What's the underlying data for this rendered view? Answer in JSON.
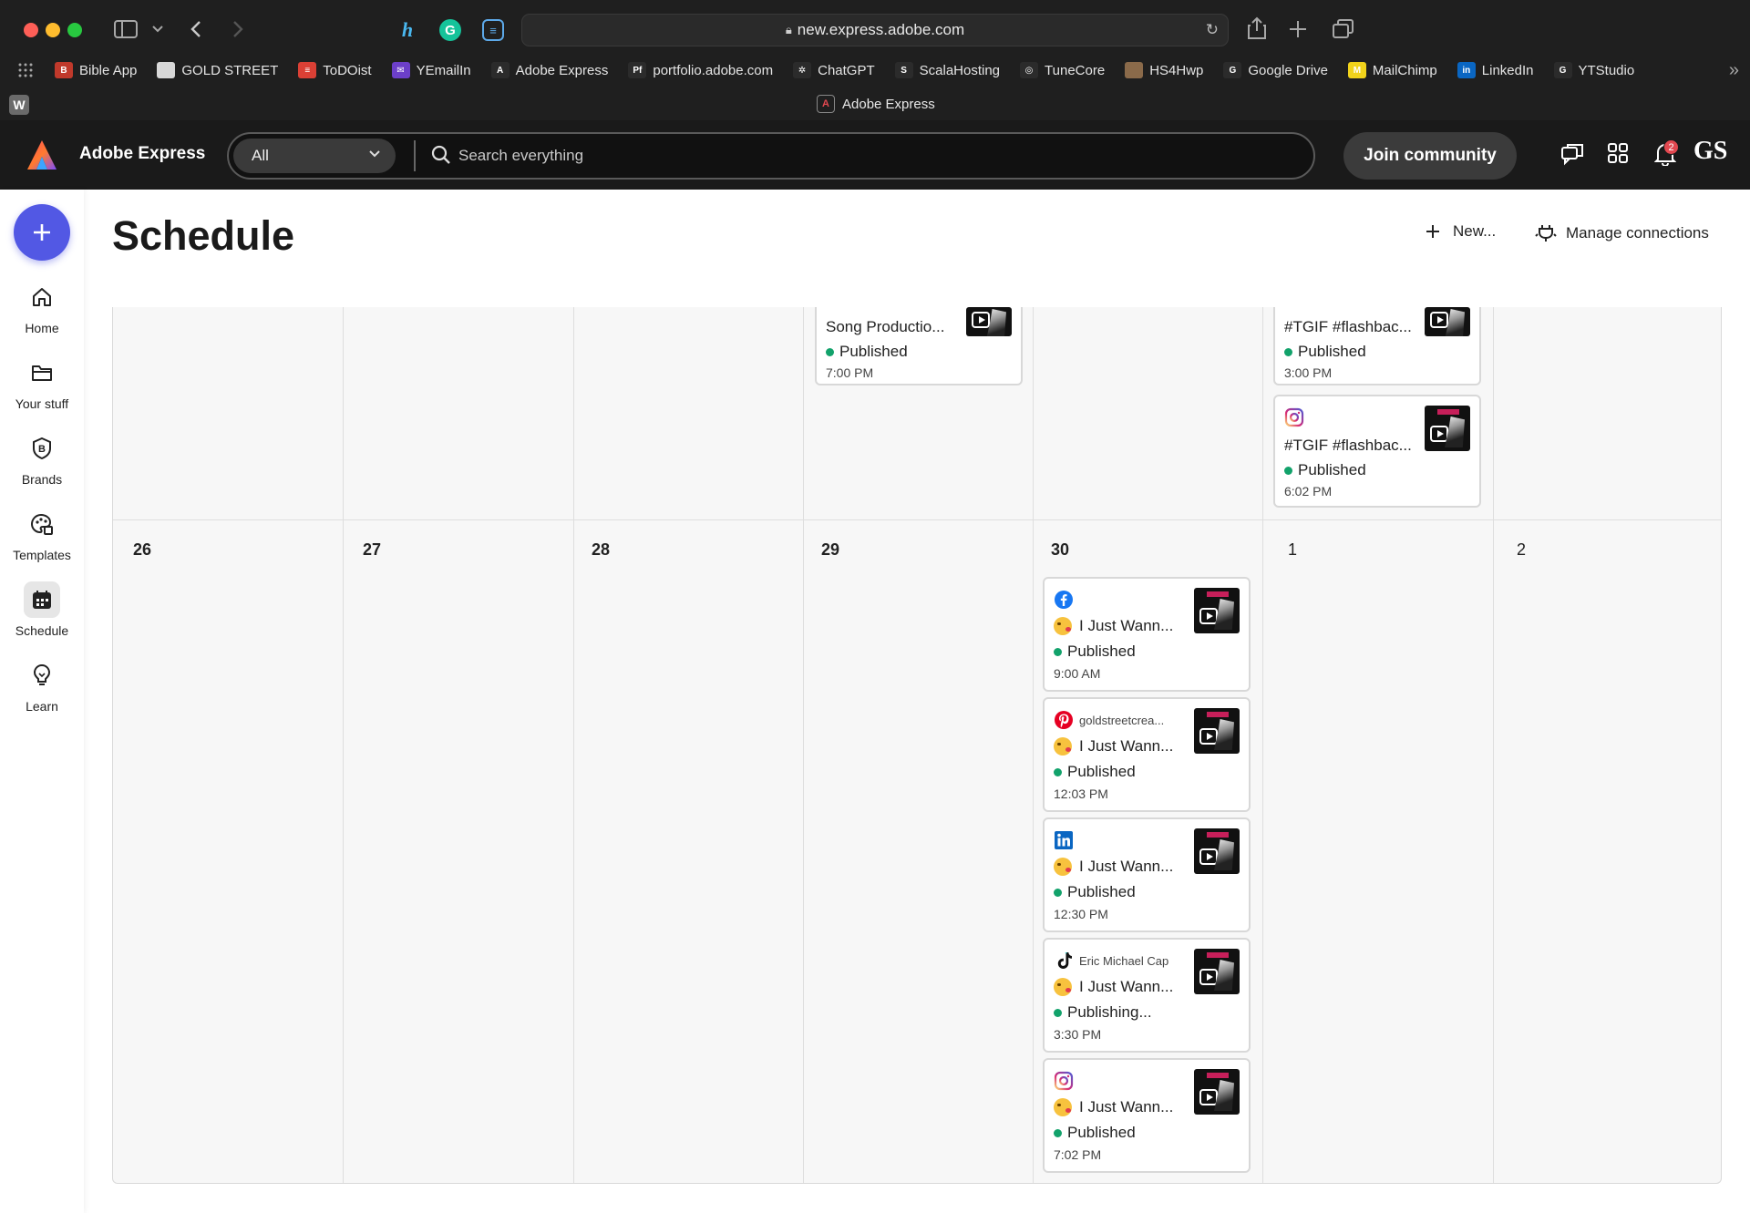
{
  "browser": {
    "url": "new.express.adobe.com",
    "tab_title": "Adobe Express",
    "bookmarks": [
      {
        "label": "Bible App",
        "color": "#c0392b",
        "glyph": "B"
      },
      {
        "label": "GOLD STREET",
        "color": "#d8d8d8",
        "glyph": ""
      },
      {
        "label": "ToDOist",
        "color": "#db4035",
        "glyph": "≡"
      },
      {
        "label": "YEmailIn",
        "color": "#6c3fc9",
        "glyph": "✉"
      },
      {
        "label": "Adobe Express",
        "color": "#2b2b2b",
        "glyph": "A"
      },
      {
        "label": "portfolio.adobe.com",
        "color": "#2b2b2b",
        "glyph": "Pf"
      },
      {
        "label": "ChatGPT",
        "color": "#2b2b2b",
        "glyph": "✲"
      },
      {
        "label": "ScalaHosting",
        "color": "#2b2b2b",
        "glyph": "S"
      },
      {
        "label": "TuneCore",
        "color": "#2b2b2b",
        "glyph": "◎"
      },
      {
        "label": "HS4Hwp",
        "color": "#8a6a4a",
        "glyph": ""
      },
      {
        "label": "Google Drive",
        "color": "#2b2b2b",
        "glyph": "G"
      },
      {
        "label": "MailChimp",
        "color": "#f2d31b",
        "glyph": "M"
      },
      {
        "label": "LinkedIn",
        "color": "#0a66c2",
        "glyph": "in"
      },
      {
        "label": "YTStudio",
        "color": "#2b2b2b",
        "glyph": "G"
      }
    ]
  },
  "header": {
    "app_name": "Adobe Express",
    "filter_value": "All",
    "search_placeholder": "Search everything",
    "join_label": "Join community",
    "notification_count": "2",
    "avatar_initials": "GS"
  },
  "sidebar": {
    "items": [
      {
        "label": "Home",
        "icon": "home-icon"
      },
      {
        "label": "Your stuff",
        "icon": "folder-icon"
      },
      {
        "label": "Brands",
        "icon": "brand-icon"
      },
      {
        "label": "Templates",
        "icon": "templates-icon"
      },
      {
        "label": "Schedule",
        "icon": "calendar-icon",
        "active": true
      },
      {
        "label": "Learn",
        "icon": "lightbulb-icon"
      }
    ]
  },
  "main": {
    "title": "Schedule",
    "new_label": "New...",
    "manage_label": "Manage connections"
  },
  "calendar": {
    "day_numbers": [
      {
        "label": "26",
        "bold": true
      },
      {
        "label": "27",
        "bold": true
      },
      {
        "label": "28",
        "bold": true
      },
      {
        "label": "29",
        "bold": true
      },
      {
        "label": "30",
        "bold": true
      },
      {
        "label": "1",
        "bold": false
      },
      {
        "label": "2",
        "bold": false
      }
    ],
    "top_week_posts": [
      {
        "column": 3,
        "title": "Song Productio...",
        "status": "Published",
        "time": "7:00 PM"
      },
      {
        "column": 5,
        "title": "#TGIF #flashbac...",
        "status": "Published",
        "time": "3:00 PM"
      },
      {
        "column": 5,
        "network": "instagram",
        "title": "#TGIF #flashbac...",
        "status": "Published",
        "time": "6:02 PM"
      }
    ],
    "day30_posts": [
      {
        "network": "facebook",
        "account": "",
        "title": "I Just Wann...",
        "status": "Published",
        "time": "9:00 AM"
      },
      {
        "network": "pinterest",
        "account": "goldstreetcrea...",
        "title": "I Just Wann...",
        "status": "Published",
        "time": "12:03 PM"
      },
      {
        "network": "linkedin",
        "account": "",
        "title": "I Just Wann...",
        "status": "Published",
        "time": "12:30 PM"
      },
      {
        "network": "tiktok",
        "account": "Eric Michael Cap",
        "title": "I Just Wann...",
        "status": "Publishing...",
        "time": "3:30 PM"
      },
      {
        "network": "instagram",
        "account": "",
        "title": "I Just Wann...",
        "status": "Published",
        "time": "7:02 PM"
      }
    ]
  },
  "colors": {
    "accent": "#5258e4",
    "published": "#12a26b",
    "facebook": "#1877f2",
    "pinterest": "#e60023",
    "linkedin": "#0a66c2"
  }
}
